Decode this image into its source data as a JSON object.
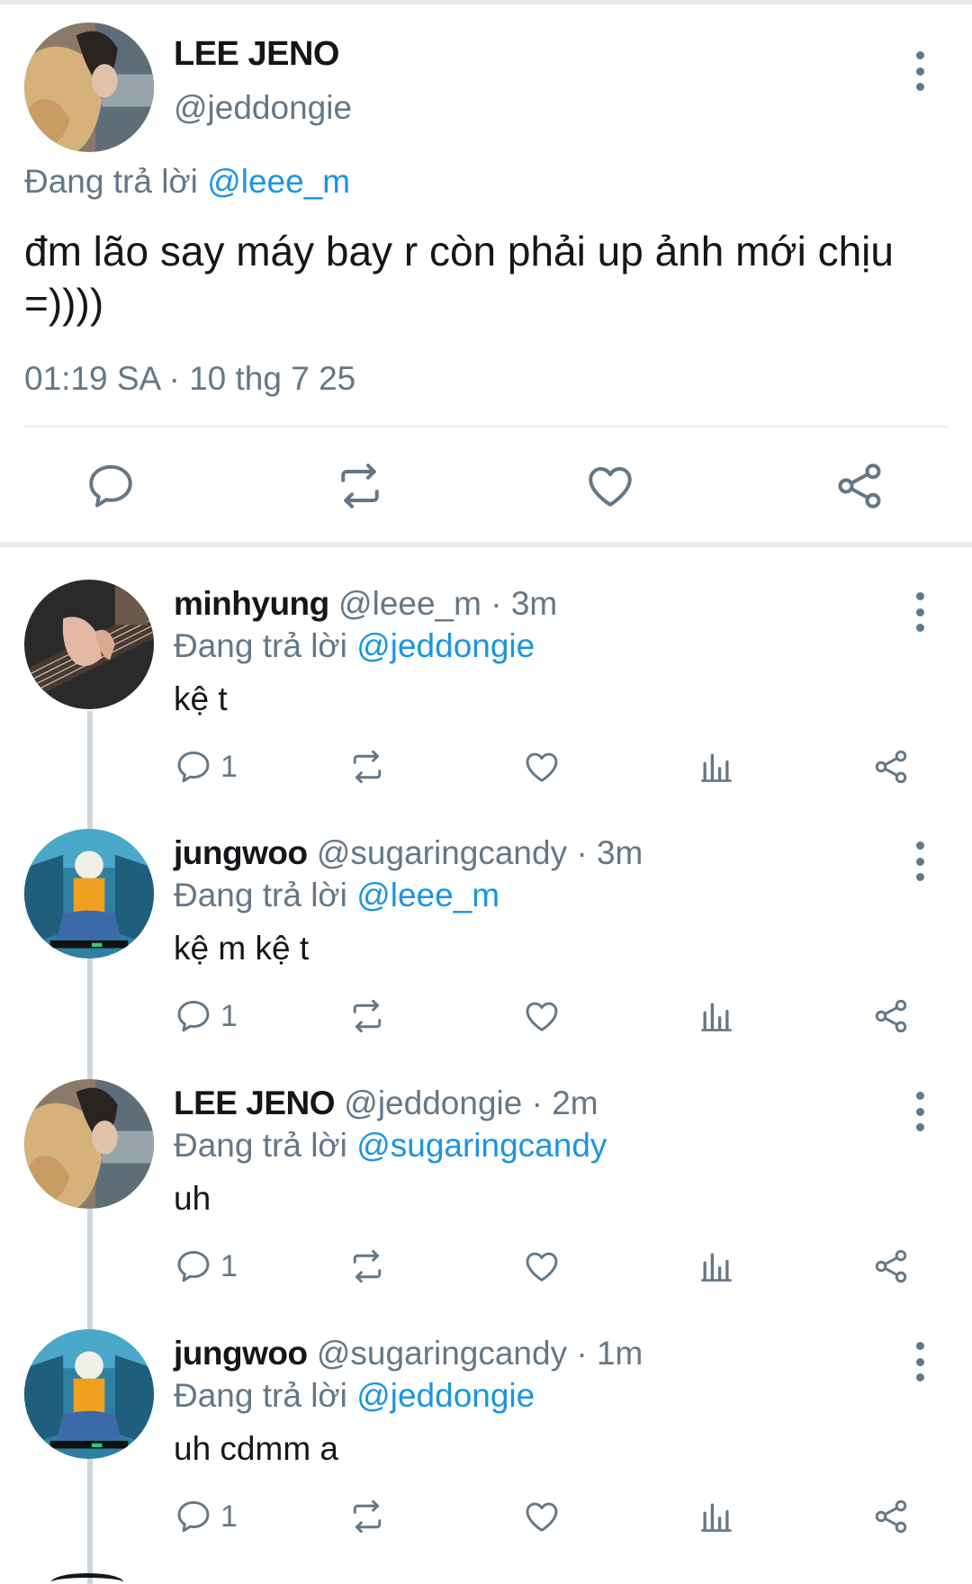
{
  "colors": {
    "accent": "#1b95e0",
    "muted": "#657786",
    "text": "#14171a",
    "divider": "#e6ecf0"
  },
  "main_tweet": {
    "name": "LEE JENO",
    "handle": "@jeddongie",
    "replying_prefix": "Đang trả lời",
    "replying_to": "@leee_m",
    "text": "đm lão say máy bay r còn phải up ảnh mới chịu =))))",
    "timestamp": "01:19 SA · 10 thg 7 25",
    "actions": [
      {
        "icon": "reply-icon"
      },
      {
        "icon": "retweet-icon"
      },
      {
        "icon": "like-icon"
      },
      {
        "icon": "share-icon"
      }
    ],
    "avatar_icon": "avatar-jeno"
  },
  "replies": [
    {
      "name": "minhyung",
      "meta": "@leee_m · 3m",
      "replying_prefix": "Đang trả lời",
      "replying_to": "@jeddongie",
      "text": "kệ t",
      "reply_count": "1",
      "avatar_icon": "avatar-guitar"
    },
    {
      "name": "jungwoo",
      "meta": "@sugaringcandy · 3m",
      "replying_prefix": "Đang trả lời",
      "replying_to": "@leee_m",
      "text": "kệ m kệ t",
      "reply_count": "1",
      "avatar_icon": "avatar-jungwoo"
    },
    {
      "name": "LEE JENO",
      "meta": "@jeddongie · 2m",
      "replying_prefix": "Đang trả lời",
      "replying_to": "@sugaringcandy",
      "text": "uh",
      "reply_count": "1",
      "avatar_icon": "avatar-jeno"
    },
    {
      "name": "jungwoo",
      "meta": "@sugaringcandy · 1m",
      "replying_prefix": "Đang trả lời",
      "replying_to": "@jeddongie",
      "text": "uh cdmm a",
      "reply_count": "1",
      "avatar_icon": "avatar-jungwoo"
    }
  ]
}
